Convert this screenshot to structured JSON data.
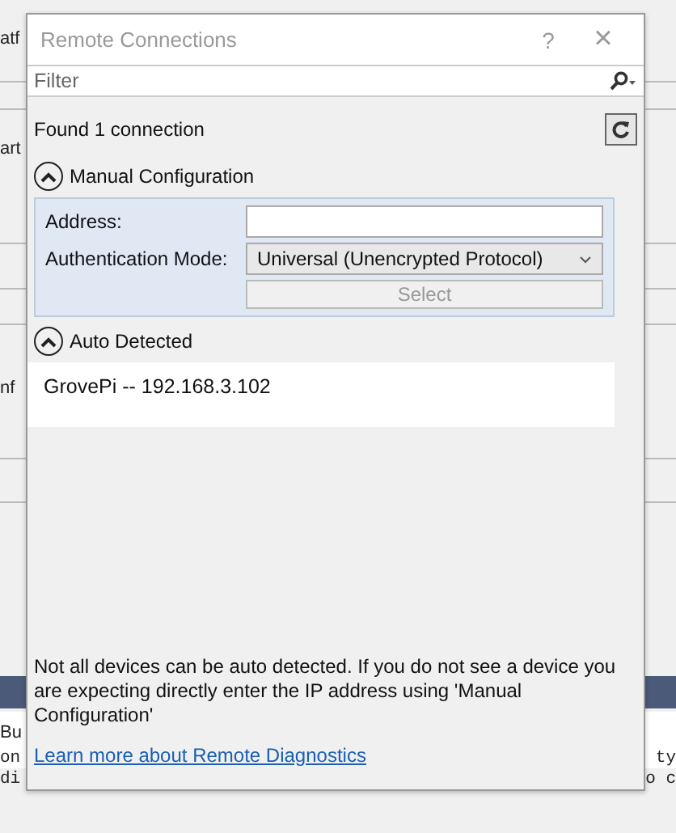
{
  "background": {
    "left_texts": [
      {
        "text": "atf",
        "kind": "plain"
      },
      {
        "text": "art",
        "kind": "plain"
      },
      {
        "text": "nf",
        "kind": "plain"
      },
      {
        "text": "Bu",
        "kind": "plain"
      },
      {
        "text": "on",
        "kind": "code"
      },
      {
        "text": "di",
        "kind": "code"
      }
    ],
    "right_texts": [
      {
        "text": "ty",
        "kind": "code"
      },
      {
        "text": "o c",
        "kind": "code"
      }
    ]
  },
  "window": {
    "title": "Remote Connections",
    "help": "?",
    "close": "×"
  },
  "filter": {
    "placeholder": "Filter"
  },
  "status": "Found 1 connection",
  "manual": {
    "title": "Manual Configuration",
    "expanded": true,
    "address_label": "Address:",
    "auth_label": "Authentication Mode:",
    "auth_mode": "Universal (Unencrypted Protocol)",
    "select_button": {
      "label": "Select",
      "disabled": true
    }
  },
  "auto": {
    "title": "Auto Detected",
    "expanded": true,
    "devices": [
      {
        "label": "GrovePi -- 192.168.3.102",
        "selected": false
      }
    ]
  },
  "note": "Not all devices can be auto detected. If you do not see a device you are expecting directly enter the IP address using 'Manual Configuration'",
  "link": "Learn more about Remote Diagnostics"
}
